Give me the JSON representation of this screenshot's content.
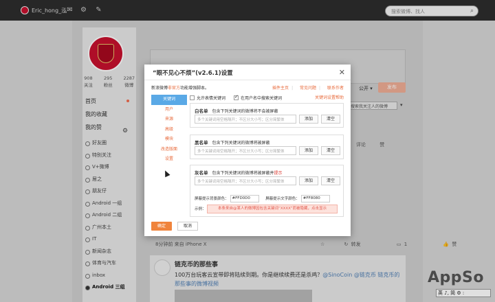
{
  "topbar": {
    "username": "Eric_hong_泓",
    "search_placeholder": "搜索微博、找人"
  },
  "profile": {
    "stats": [
      {
        "value": "908",
        "label": "关注"
      },
      {
        "value": "295",
        "label": "粉丝"
      },
      {
        "value": "2287",
        "label": "微博"
      }
    ],
    "nav": [
      "首页",
      "我的收藏",
      "我的赞"
    ],
    "groups": [
      "好友圈",
      "特别关注",
      "V+微博",
      "居之",
      "朋友仔",
      "Android 一组",
      "Android 二组",
      "广州本土",
      "IT",
      "新闻杂志",
      "体育与汽车",
      "inbox",
      "Android 三组"
    ]
  },
  "composer": {
    "public_label": "公开 ▾",
    "publish_label": "发布",
    "filter_placeholder": "搜索我关注人的微博"
  },
  "feed": {
    "actions_top": [
      "评论",
      "赞"
    ],
    "meta": "8分钟前 来自 iPhone X",
    "actions": [
      "转发",
      "1",
      "赞"
    ],
    "post": {
      "author": "链克币的那些事",
      "text_prefix": "100万台玩客云宣带即将陆续到期。你是继续续费还是杀鸡？",
      "mention": "@SinoCoin @链克币",
      "text_suffix": " 链克币的那些事的微博视频"
    }
  },
  "dialog": {
    "title": "“眼不见心不烦”(v2.6.1)设置",
    "desc_prefix": "新浪微博",
    "desc_highlight": "非官方",
    "desc_suffix": "功能增强脚本。",
    "links": [
      "插件主页",
      "常见问题",
      "联系作者"
    ],
    "help_link": "关键词设置帮助",
    "tabs": [
      "关键词",
      "用户",
      "来源",
      "高级",
      "模块",
      "改造版面",
      "设置"
    ],
    "options": [
      {
        "label": "允许表情关键词",
        "checked": false
      },
      {
        "label": "在用户名中搜索关键词",
        "checked": true
      }
    ],
    "whitelist": {
      "name": "白名单",
      "desc": "包含下列关键词的微博将不会被屏蔽"
    },
    "blacklist": {
      "name": "黑名单",
      "desc": "包含下列关键词的微博将被屏蔽"
    },
    "graylist": {
      "name": "灰名单",
      "desc": "包含下列关键词的微博将被屏蔽并",
      "desc_red": "提示"
    },
    "input_placeholder": "多个关键词用空格隔开；不区分大小写；区分简繁体",
    "add_label": "添加",
    "clear_label": "清空",
    "bg_color_label": "屏蔽提示背景颜色：",
    "bg_color_value": "#FFD0D0",
    "text_color_label": "屏蔽提示文字颜色：",
    "text_color_value": "#FF8080",
    "example_label": "示例：",
    "example_text": "本条来自@某人的微博因包含关键词“XXXX”而被隐藏，点击显示",
    "ok_label": "确定",
    "cancel_label": "取消"
  },
  "watermark": "AppSo",
  "ime": "英 ♪, 简 ⚙ :"
}
